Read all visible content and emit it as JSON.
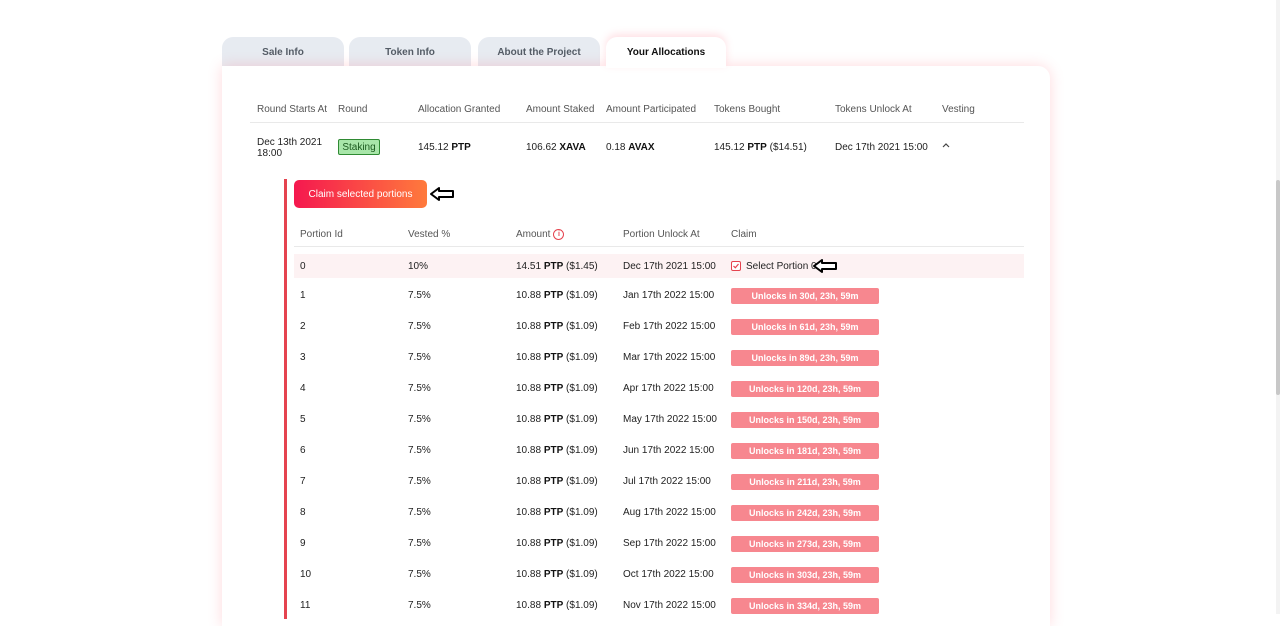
{
  "tabs": [
    {
      "label": "Sale Info",
      "active": false
    },
    {
      "label": "Token Info",
      "active": false
    },
    {
      "label": "About the Project",
      "active": false
    },
    {
      "label": "Your Allocations",
      "active": true
    }
  ],
  "allocations": {
    "headers": [
      "Round Starts At",
      "Round",
      "Allocation Granted",
      "Amount Staked",
      "Amount Participated",
      "Tokens Bought",
      "Tokens Unlock At",
      "Vesting"
    ],
    "row": {
      "round_starts_line1": "Dec 13th 2021",
      "round_starts_line2": "18:00",
      "round": "Staking",
      "allocation_value": "145.12",
      "allocation_unit": "PTP",
      "staked_value": "106.62",
      "staked_unit": "XAVA",
      "participated_value": "0.18",
      "participated_unit": "AVAX",
      "bought_value": "145.12",
      "bought_unit": "PTP",
      "bought_usd": "($14.51)",
      "unlock_at": "Dec 17th 2021 15:00",
      "vesting_icon": "chevron-up-icon"
    }
  },
  "vesting": {
    "claim_button": "Claim selected portions",
    "headers": [
      "Portion Id",
      "Vested %",
      "Amount",
      "Portion Unlock At",
      "Claim"
    ],
    "amount_info_icon": "info-icon",
    "arrow_icon": "arrow-left-icon",
    "rows": [
      {
        "id": "0",
        "pct": "10%",
        "amount": "14.51",
        "unit": "PTP",
        "usd": "($1.45)",
        "date": "Dec 17th 2021 15:00",
        "claim": "Select Portion 0",
        "checked": true
      },
      {
        "id": "1",
        "pct": "7.5%",
        "amount": "10.88",
        "unit": "PTP",
        "usd": "($1.09)",
        "date": "Jan 17th 2022 15:00",
        "claim": "Unlocks in 30d, 23h, 59m"
      },
      {
        "id": "2",
        "pct": "7.5%",
        "amount": "10.88",
        "unit": "PTP",
        "usd": "($1.09)",
        "date": "Feb 17th 2022 15:00",
        "claim": "Unlocks in 61d, 23h, 59m"
      },
      {
        "id": "3",
        "pct": "7.5%",
        "amount": "10.88",
        "unit": "PTP",
        "usd": "($1.09)",
        "date": "Mar 17th 2022 15:00",
        "claim": "Unlocks in 89d, 23h, 59m"
      },
      {
        "id": "4",
        "pct": "7.5%",
        "amount": "10.88",
        "unit": "PTP",
        "usd": "($1.09)",
        "date": "Apr 17th 2022 15:00",
        "claim": "Unlocks in 120d, 23h, 59m"
      },
      {
        "id": "5",
        "pct": "7.5%",
        "amount": "10.88",
        "unit": "PTP",
        "usd": "($1.09)",
        "date": "May 17th 2022 15:00",
        "claim": "Unlocks in 150d, 23h, 59m"
      },
      {
        "id": "6",
        "pct": "7.5%",
        "amount": "10.88",
        "unit": "PTP",
        "usd": "($1.09)",
        "date": "Jun 17th 2022 15:00",
        "claim": "Unlocks in 181d, 23h, 59m"
      },
      {
        "id": "7",
        "pct": "7.5%",
        "amount": "10.88",
        "unit": "PTP",
        "usd": "($1.09)",
        "date": "Jul 17th 2022 15:00",
        "claim": "Unlocks in 211d, 23h, 59m"
      },
      {
        "id": "8",
        "pct": "7.5%",
        "amount": "10.88",
        "unit": "PTP",
        "usd": "($1.09)",
        "date": "Aug 17th 2022 15:00",
        "claim": "Unlocks in 242d, 23h, 59m"
      },
      {
        "id": "9",
        "pct": "7.5%",
        "amount": "10.88",
        "unit": "PTP",
        "usd": "($1.09)",
        "date": "Sep 17th 2022 15:00",
        "claim": "Unlocks in 273d, 23h, 59m"
      },
      {
        "id": "10",
        "pct": "7.5%",
        "amount": "10.88",
        "unit": "PTP",
        "usd": "($1.09)",
        "date": "Oct 17th 2022 15:00",
        "claim": "Unlocks in 303d, 23h, 59m"
      },
      {
        "id": "11",
        "pct": "7.5%",
        "amount": "10.88",
        "unit": "PTP",
        "usd": "($1.09)",
        "date": "Nov 17th 2022 15:00",
        "claim": "Unlocks in 334d, 23h, 59m"
      }
    ]
  },
  "colors": {
    "accent": "#e5434f",
    "staking_badge": "#a8e6a9",
    "unlock_button": "#f7878f"
  }
}
